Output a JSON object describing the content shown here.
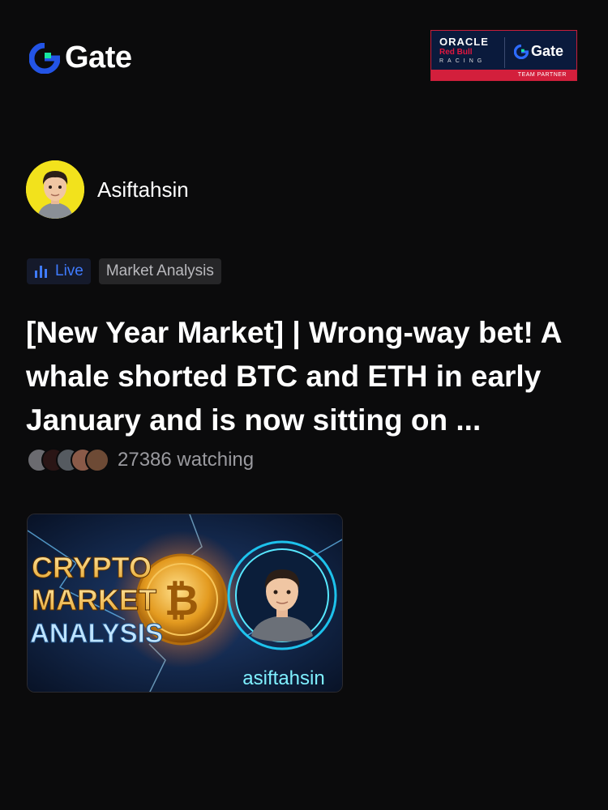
{
  "brand": {
    "name": "Gate",
    "logo_icon": "gate-logo-icon",
    "accent": "#2354e6",
    "accent_green": "#17e6a1"
  },
  "partner": {
    "line1": "ORACLE",
    "line2": "Red Bull",
    "line3": "RACING",
    "brand": "Gate",
    "badge": "TEAM PARTNER"
  },
  "author": {
    "name": "Asiftahsin",
    "avatar_bg": "#f2e21c"
  },
  "tags": {
    "live": "Live",
    "category": "Market Analysis"
  },
  "post": {
    "title": "[New Year Market] | Wrong-way bet! A whale shorted BTC and ETH in early January and is now sitting on ...",
    "watching": "27386 watching"
  },
  "thumbnail": {
    "line1": "CRYPTO",
    "line2": "MARKET",
    "line3": "ANALYSIS",
    "handle": "asiftahsin",
    "coin_symbol": "₿"
  }
}
